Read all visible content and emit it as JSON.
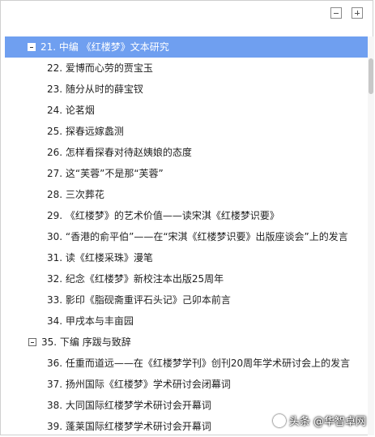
{
  "toolbar": {
    "collapse_icon": "collapse-all-icon",
    "expand_icon": "expand-all-icon"
  },
  "tree": {
    "items": [
      {
        "label": "21.  中编 《红楼梦》文本研究",
        "level": 0,
        "expanded": true,
        "selected": true
      },
      {
        "label": "22.  爱博而心劳的贾宝玉",
        "level": 1
      },
      {
        "label": "23.  随分从时的薛宝钗",
        "level": 1
      },
      {
        "label": "24.  论茗烟",
        "level": 1
      },
      {
        "label": "25.  探春远嫁蠡测",
        "level": 1
      },
      {
        "label": "26.  怎样看探春对待赵姨娘的态度",
        "level": 1
      },
      {
        "label": "27.  这“芙蓉”不是那“芙蓉”",
        "level": 1
      },
      {
        "label": "28.  三次葬花",
        "level": 1
      },
      {
        "label": "29.  《红楼梦》的艺术价值——读宋淇《红楼梦识要》",
        "level": 1
      },
      {
        "label": "30.  “香港的俞平伯”——在“宋淇《红楼梦识要》出版座谈会”上的发言",
        "level": 1
      },
      {
        "label": "31.  读《红楼采珠》漫笔",
        "level": 1
      },
      {
        "label": "32.  纪念《红楼梦》新校注本出版25周年",
        "level": 1
      },
      {
        "label": "33.  影印《脂砚斋重评石头记》己卯本前言",
        "level": 1
      },
      {
        "label": "34.  甲戌本与丰亩园",
        "level": 1
      },
      {
        "label": "35.  下编  序跋与致辞",
        "level": 0,
        "expanded": true,
        "selected": false
      },
      {
        "label": "36.  任重而道远——在《红楼梦学刊》创刊20周年学术研讨会上的发言",
        "level": 1
      },
      {
        "label": "37.  扬州国际《红楼梦》学术研讨会闭幕词",
        "level": 1
      },
      {
        "label": "38.  大同国际红楼梦学术研讨会开幕词",
        "level": 1
      },
      {
        "label": "39.  蓬莱国际红楼梦学术研讨会开幕词",
        "level": 1
      }
    ]
  },
  "watermark": {
    "text": "头条 @华智卓网"
  }
}
